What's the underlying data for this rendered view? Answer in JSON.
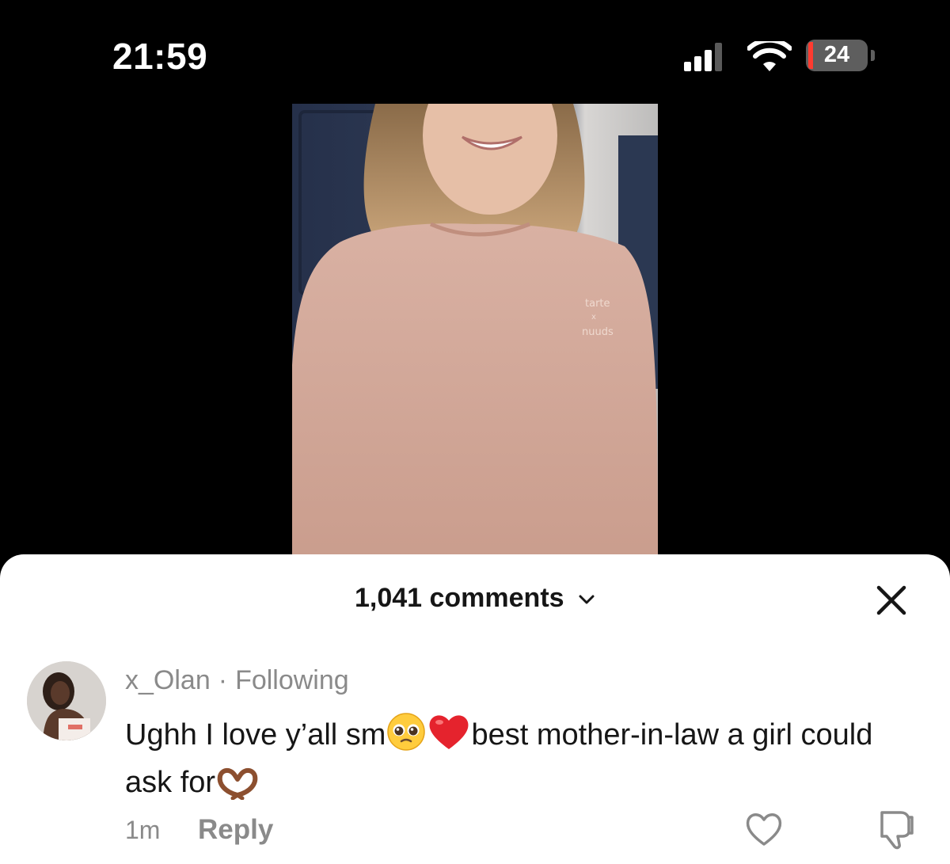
{
  "status_bar": {
    "time": "21:59",
    "battery_level": "24",
    "icons": [
      "cellular-signal-icon",
      "wifi-icon",
      "battery-icon"
    ]
  },
  "video": {
    "sweatshirt_print": [
      "tarte",
      "x",
      "nuuds"
    ]
  },
  "comments_sheet": {
    "title": "1,041 comments",
    "icons": [
      "chevron-down-icon",
      "close-icon"
    ]
  },
  "comment": {
    "username": "x_Olan",
    "separator": "·",
    "follow_status": "Following",
    "text_part1": "Ughh I love y’all sm",
    "text_part2": "best mother-in-law a girl could ask for",
    "emojis": [
      "pleading-face-icon",
      "red-heart-icon",
      "heart-hands-icon"
    ],
    "time": "1m",
    "reply_label": "Reply",
    "icons": [
      "like-heart-icon",
      "dislike-icon"
    ]
  },
  "colors": {
    "background": "#000000",
    "sheet": "#ffffff",
    "text_primary": "#161616",
    "text_secondary": "#8a8a8a",
    "battery_low": "#ff3b30",
    "sweatshirt": "#d3a99b"
  }
}
